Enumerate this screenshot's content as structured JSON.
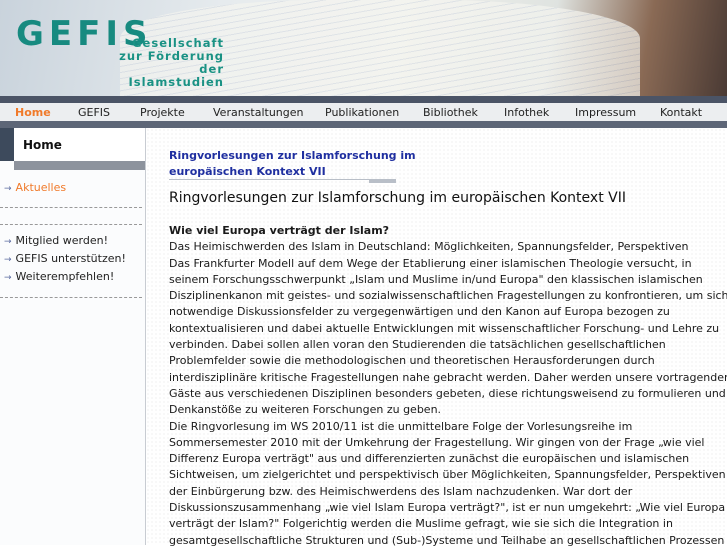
{
  "header": {
    "logo": "GEFIS",
    "tagline": [
      "Gesellschaft",
      "zur Förderung",
      "der Islamstudien"
    ]
  },
  "nav": [
    "Home",
    "GEFIS",
    "Projekte",
    "Veranstaltungen",
    "Publikationen",
    "Bibliothek",
    "Infothek",
    "Impressum",
    "Kontakt"
  ],
  "sidebar": {
    "title": "Home",
    "links1": [
      "Aktuelles"
    ],
    "links2": [
      "Mitglied werden!",
      "GEFIS unterstützen!",
      "Weiterempfehlen!"
    ]
  },
  "main": {
    "breadcrumb": [
      "Ringvorlesungen zur Islamforschung im",
      "europäischen Kontext VII"
    ],
    "title": "Ringvorlesungen zur Islamforschung im europäischen Kontext VII",
    "question": "Wie viel Europa verträgt der Islam?",
    "lines": [
      "Das Heimischwerden des Islam in Deutschland: Möglichkeiten, Spannungsfelder, Perspektiven",
      "Das Frankfurter Modell auf dem Wege der Etablierung einer islamischen Theologie versucht, in",
      "seinem Forschungsschwerpunkt „Islam und Muslime in/und Europa\" den klassischen islamischen",
      "Disziplinenkanon mit geistes- und sozialwissenschaftlichen Fragestellungen zu konfrontieren, um sich",
      "notwendige Diskussionsfelder zu vergegenwärtigen und den Kanon auf Europa bezogen zu",
      "kontextualisieren und dabei aktuelle Entwicklungen mit wissenschaftlicher Forschung- und Lehre zu",
      "verbinden. Dabei sollen allen voran den Studierenden die tatsächlichen gesellschaftlichen",
      "Problemfelder sowie die methodologischen und theoretischen Herausforderungen durch",
      "interdisziplinäre kritische Fragestellungen nahe gebracht werden. Daher werden unsere vortragenden",
      "Gäste aus verschiedenen Disziplinen besonders gebeten, diese richtungsweisend zu formulieren und",
      "Denkanstöße zu weiteren Forschungen zu geben.",
      "Die Ringvorlesung im WS 2010/11 ist die unmittelbare Folge der Vorlesungsreihe im",
      "Sommersemester 2010 mit der Umkehrung der Fragestellung. Wir gingen von der Frage „wie viel",
      "Differenz Europa verträgt\" aus und differenzierten zunächst die europäischen und islamischen",
      "Sichtweisen, um zielgerichtet und perspektivisch über Möglichkeiten, Spannungsfelder, Perspektiven",
      "der Einbürgerung bzw. des Heimischwerdens des Islam nachzudenken. War dort der",
      "Diskussionszusammenhang „wie viel Islam Europa verträgt?\", ist er nun umgekehrt: „Wie viel Europa",
      "verträgt der Islam?\" Folgerichtig werden die Muslime gefragt, wie sie sich die Integration in",
      "gesamtgesellschaftliche Strukturen und (Sub-)Systeme und Teilhabe an gesellschaftlichen Prozessen"
    ]
  }
}
